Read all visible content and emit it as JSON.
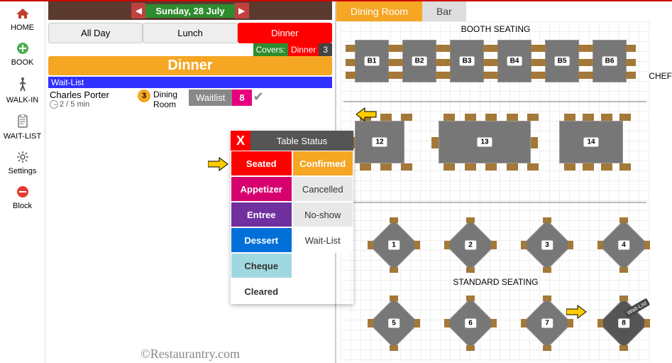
{
  "sidebar": [
    {
      "label": "HOME",
      "icon": "home"
    },
    {
      "label": "BOOK",
      "icon": "plus"
    },
    {
      "label": "WALK-IN",
      "icon": "walk"
    },
    {
      "label": "WAIT-LIST",
      "icon": "clip"
    },
    {
      "label": "Settings",
      "icon": "gear"
    },
    {
      "label": "Block",
      "icon": "minus"
    }
  ],
  "date": "Sunday, 28 July",
  "meals": [
    "All Day",
    "Lunch",
    "Dinner"
  ],
  "meals_active": 2,
  "covers": {
    "label": "Covers:",
    "service": "Dinner",
    "count": "3"
  },
  "service_bar": "Dinner",
  "waitlist_header": "Wait-List",
  "reservation": {
    "name": "Charles Porter",
    "wait": "2 / 5 min",
    "party": "3",
    "room": "Dining Room",
    "tag": "Waitlist",
    "table": "8"
  },
  "status_popup": {
    "title": "Table Status",
    "left": [
      "Seated",
      "Appetizer",
      "Entree",
      "Dessert",
      "Cheque",
      "Cleared"
    ],
    "right": [
      "Confirmed",
      "Cancelled",
      "No-show",
      "Wait-List"
    ]
  },
  "watermark": "©Restaurantry.com",
  "plan_tabs": [
    "Dining Room",
    "Bar"
  ],
  "zones": {
    "booth": "BOOTH SEATING",
    "standard": "STANDARD SEATING",
    "chef": "CHEF"
  },
  "booths": [
    "B1",
    "B2",
    "B3",
    "B4",
    "B5",
    "B6"
  ],
  "rect_tables": [
    "12",
    "13",
    "14"
  ],
  "diamonds_row1": [
    "1",
    "2",
    "3",
    "4"
  ],
  "diamonds_row2": [
    "5",
    "6",
    "7",
    "8"
  ],
  "table8_badge": "Wait-List"
}
